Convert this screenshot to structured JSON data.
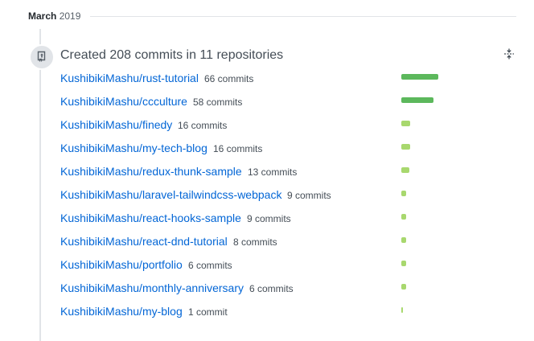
{
  "header": {
    "month": "March",
    "year": "2019"
  },
  "summary": {
    "title": "Created 208 commits in 11 repositories",
    "icon": "repo-push-icon",
    "toggle_icon": "fold-icon"
  },
  "colors": {
    "link": "#0366d6",
    "bar_dark": "#5cb85c",
    "bar_light": "#a8d86e"
  },
  "repositories": [
    {
      "name": "KushibikiMashu/rust-tutorial",
      "commits_label": "66 commits",
      "commits": 66
    },
    {
      "name": "KushibikiMashu/ccculture",
      "commits_label": "58 commits",
      "commits": 58
    },
    {
      "name": "KushibikiMashu/finedy",
      "commits_label": "16 commits",
      "commits": 16
    },
    {
      "name": "KushibikiMashu/my-tech-blog",
      "commits_label": "16 commits",
      "commits": 16
    },
    {
      "name": "KushibikiMashu/redux-thunk-sample",
      "commits_label": "13 commits",
      "commits": 13
    },
    {
      "name": "KushibikiMashu/laravel-tailwindcss-webpack",
      "commits_label": "9 commits",
      "commits": 9
    },
    {
      "name": "KushibikiMashu/react-hooks-sample",
      "commits_label": "9 commits",
      "commits": 9
    },
    {
      "name": "KushibikiMashu/react-dnd-tutorial",
      "commits_label": "8 commits",
      "commits": 8
    },
    {
      "name": "KushibikiMashu/portfolio",
      "commits_label": "6 commits",
      "commits": 6
    },
    {
      "name": "KushibikiMashu/monthly-anniversary",
      "commits_label": "6 commits",
      "commits": 6
    },
    {
      "name": "KushibikiMashu/my-blog",
      "commits_label": "1 commit",
      "commits": 1
    }
  ]
}
